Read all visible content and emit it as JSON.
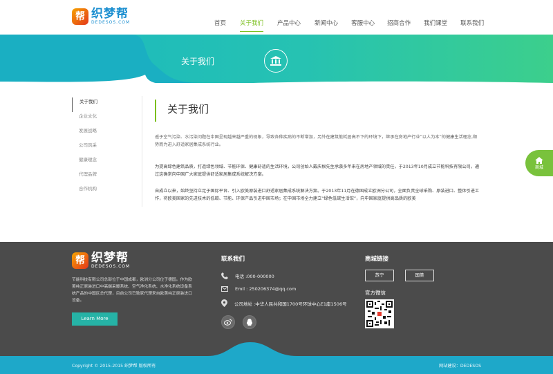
{
  "logo": {
    "badge": "帮",
    "name": "织梦帮",
    "sub": "DEDESOS.COM"
  },
  "nav": [
    {
      "label": "首页",
      "active": false
    },
    {
      "label": "关于我们",
      "active": true
    },
    {
      "label": "产品中心",
      "active": false
    },
    {
      "label": "新闻中心",
      "active": false
    },
    {
      "label": "客服中心",
      "active": false
    },
    {
      "label": "招商合作",
      "active": false
    },
    {
      "label": "我们课堂",
      "active": false
    },
    {
      "label": "联系我们",
      "active": false
    }
  ],
  "banner": {
    "title": "关于我们"
  },
  "sidebar": [
    {
      "label": "关于我们",
      "active": true
    },
    {
      "label": "企业文化",
      "active": false
    },
    {
      "label": "发展战略",
      "active": false
    },
    {
      "label": "公司风采",
      "active": false
    },
    {
      "label": "健康理念",
      "active": false
    },
    {
      "label": "代理品牌",
      "active": false
    },
    {
      "label": "合作机构",
      "active": false
    }
  ],
  "main": {
    "title": "关于我们",
    "paragraphs": [
      " 遥于空气污染、水污染问题在中国呈现越来越严重的现象，导致各种疾病的不断增加，另外在建筑能耗居高不下的环境下，继承在房地产行业“以人为本”的健康生活理念,顺势而为进入舒适家居集成系统行业。",
      "为提高绿色建筑品质，打造绿色领域、节能环保、健康舒适的生活环境，公司创始人戴庆根先生承袭多年来在房地产领域的责任，于2013年10月成立节能科技有限公司，通过这确常向中国广大家庭提供舒适家居集成系统解决方案。",
      "自成立以来，始终坚持立足于国际平台、引入欧美原装进口舒适家居集成系统解决方案。于2013年11月在德国成立欧洲分公司，全面负责全球采购、原装进口、整体引进工作，将欧美国家的先进技术的低碳、节能、环保产品引进中国市场；在中国市场全力建立“绿色低碳生活馆”，向中国家庭提供高品质的欧美"
    ]
  },
  "float": {
    "label": "商城"
  },
  "footer": {
    "logo": {
      "badge": "帮",
      "name": "织梦帮",
      "sub": "DEDESOS.COM"
    },
    "desc": "节能科技有限公司总部位于中国成都，欧洲分公司位于德国。作为欧美纯正原装进口中高端采暖系统、空气净化系统、水净化系统设备系统产品的中国区总代理，目前公司已致家代理来自欧美纯正原装进口设备。",
    "learn_more": "Learn More",
    "contact_title": "联系我们",
    "phone": "电话 :000-000000",
    "email": "Emil : 250206374@qq.com",
    "address": "公司地址 :中华人民共和国1700号环球中心E1座1506号",
    "shop_title": "商城链接",
    "shop_links": [
      "苏宁",
      "国美"
    ],
    "wechat_title": "官方微信",
    "copyright": "Copyright © 2015-2015 织梦帮 版权所有",
    "builder": "网站建设：DEDESOS"
  },
  "colors": {
    "accent": "#7bbf1e",
    "banner": "#26c2b2",
    "footer": "#4b4b4b",
    "bottom": "#1ea8c9"
  }
}
